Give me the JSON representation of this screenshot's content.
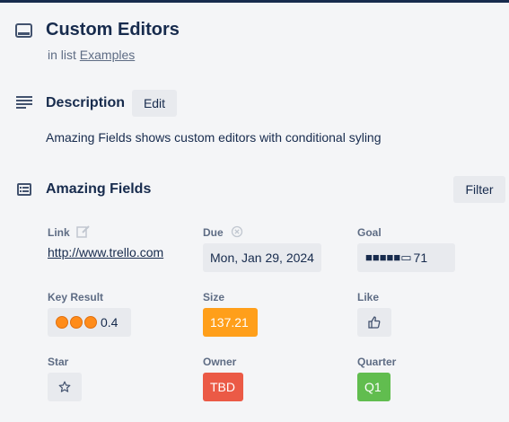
{
  "card": {
    "title": "Custom Editors",
    "in_list_prefix": "in list",
    "list_name": "Examples"
  },
  "description": {
    "heading": "Description",
    "edit_label": "Edit",
    "text": "Amazing Fields shows custom editors with conditional syling"
  },
  "amazing_fields": {
    "heading": "Amazing Fields",
    "filter_label": "Filter",
    "fields": {
      "link": {
        "label": "Link",
        "value": "http://www.trello.com"
      },
      "due": {
        "label": "Due",
        "value": "Mon, Jan 29, 2024"
      },
      "goal": {
        "label": "Goal",
        "bar_glyphs": "■■■■■▭",
        "value": "71"
      },
      "key_result": {
        "label": "Key Result",
        "dots": 3,
        "value": "0.4"
      },
      "size": {
        "label": "Size",
        "value": "137.21",
        "color": "#ff9f1a"
      },
      "like": {
        "label": "Like",
        "icon": "thumbs-up-icon"
      },
      "star": {
        "label": "Star",
        "icon": "star-icon"
      },
      "owner": {
        "label": "Owner",
        "value": "TBD",
        "color": "#eb5a46"
      },
      "quarter": {
        "label": "Quarter",
        "value": "Q1",
        "color": "#61bd4f"
      }
    }
  },
  "colors": {
    "text": "#172b4d",
    "muted": "#5e6c84",
    "button_bg": "#e8eaee",
    "page_bg": "#f4f5f7"
  }
}
